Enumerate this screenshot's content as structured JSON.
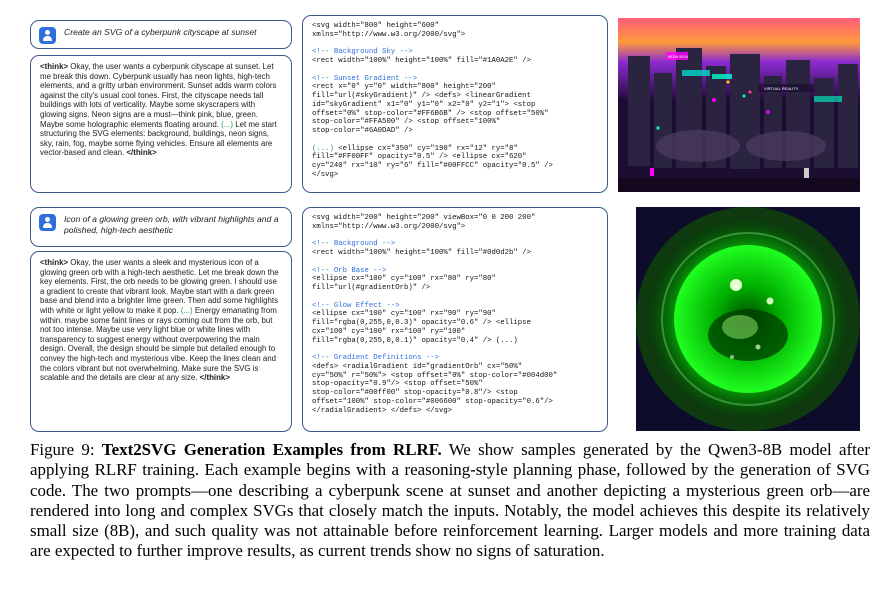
{
  "example1": {
    "prompt": "Create an SVG of a cyberpunk cityscape at sunset",
    "think_open": "<think>",
    "think_body": " Okay, the user wants a cyberpunk cityscape at sunset. Let me break this down. Cyberpunk usually has neon lights, high-tech elements, and a gritty urban environment. Sunset adds warm colors against the city's usual cool tones. First, the cityscape needs tall buildings with lots of verticality. Maybe some skyscrapers with glowing signs. Neon signs are a must—think pink, blue, green. Maybe some holographic elements floating around. ",
    "think_ellipsis": "(...)",
    "think_tail": " Let me start structuring the SVG elements: background, buildings, neon signs, sky, rain, fog, maybe some flying vehicles. Ensure all elements are vector-based and clean.",
    "think_close": "</think>",
    "code_lines": [
      {
        "t": "<svg width=\"800\" height=\"600\"",
        "c": "code"
      },
      {
        "t": "xmlns=\"http://www.w3.org/2000/svg\">",
        "c": "code"
      },
      {
        "t": "",
        "c": "blank"
      },
      {
        "t": "<!-- Background Sky -->",
        "c": "cm"
      },
      {
        "t": "<rect width=\"100%\" height=\"100%\" fill=\"#1A0A2E\" />",
        "c": "code"
      },
      {
        "t": "",
        "c": "blank"
      },
      {
        "t": "<!-- Sunset Gradient -->",
        "c": "cm"
      },
      {
        "t": "<rect x=\"0\" y=\"0\" width=\"800\" height=\"200\"",
        "c": "code"
      },
      {
        "t": "fill=\"url(#skyGradient)\" /> <defs> <linearGradient",
        "c": "code"
      },
      {
        "t": "id=\"skyGradient\" x1=\"0\" y1=\"0\" x2=\"0\" y2=\"1\"> <stop",
        "c": "code"
      },
      {
        "t": "offset=\"0%\" stop-color=\"#FF6B6B\" /> <stop offset=\"50%\"",
        "c": "code"
      },
      {
        "t": "stop-color=\"#FFA500\" /> <stop offset=\"100%\"",
        "c": "code"
      },
      {
        "t": "stop-color=\"#6A0DAD\" />",
        "c": "code"
      },
      {
        "t": "",
        "c": "blank"
      },
      {
        "t": "(...)",
        "c": "ell",
        "rest": " <ellipse cx=\"350\" cy=\"190\" rx=\"12\" ry=\"8\""
      },
      {
        "t": "fill=\"#FF00FF\" opacity=\"0.5\" /> <ellipse cx=\"620\"",
        "c": "code"
      },
      {
        "t": "cy=\"240\" rx=\"10\" ry=\"6\" fill=\"#00FFCC\" opacity=\"0.5\" />",
        "c": "code"
      },
      {
        "t": "</svg>",
        "c": "code"
      }
    ],
    "image_labels": {
      "sign1": "NEON SIGN",
      "sign2": "VIRTUAL REALITY"
    }
  },
  "example2": {
    "prompt": "Icon of a glowing green orb, with vibrant highlights and a polished, high-tech aesthetic",
    "think_open": "<think>",
    "think_body": " Okay, the user wants a sleek and mysterious icon of a glowing green orb with a high-tech aesthetic. Let me break down the key elements. First, the orb needs to be glowing green. I should use a gradient to create that vibrant look. Maybe start with a dark green base and blend into a brighter lime green. Then add some highlights with white or light yellow to make it pop. ",
    "think_ellipsis": "(...)",
    "think_tail": " Energy emanating from within. maybe some faint lines or rays coming out from the orb, but not too intense. Maybe use very light blue or white lines with transparency to suggest energy without overpowering the main design. Overall, the design should be simple but detailed enough to convey the high-tech and mysterious vibe. Keep the lines clean and the colors vibrant but not overwhelming. Make sure the SVG is scalable and the details are clear at any size.",
    "think_close": "</think>",
    "code_lines": [
      {
        "t": "<svg width=\"200\" height=\"200\" viewBox=\"0 0 200 200\"",
        "c": "code"
      },
      {
        "t": "xmlns=\"http://www.w3.org/2000/svg\">",
        "c": "code"
      },
      {
        "t": "",
        "c": "blank"
      },
      {
        "t": "<!-- Background -->",
        "c": "cm"
      },
      {
        "t": "<rect width=\"100%\" height=\"100%\" fill=\"#0d0d2b\" />",
        "c": "code"
      },
      {
        "t": "",
        "c": "blank"
      },
      {
        "t": "<!-- Orb Base -->",
        "c": "cm"
      },
      {
        "t": "<ellipse cx=\"100\" cy=\"100\" rx=\"80\" ry=\"80\"",
        "c": "code"
      },
      {
        "t": "fill=\"url(#gradientOrb)\" />",
        "c": "code"
      },
      {
        "t": "",
        "c": "blank"
      },
      {
        "t": "<!-- Glow Effect -->",
        "c": "cm"
      },
      {
        "t": "<ellipse cx=\"100\" cy=\"100\" rx=\"90\" ry=\"90\"",
        "c": "code"
      },
      {
        "t": "fill=\"rgba(0,255,0,0.3)\" opacity=\"0.6\" /> <ellipse",
        "c": "code"
      },
      {
        "t": "cx=\"100\" cy=\"100\" rx=\"100\" ry=\"100\"",
        "c": "code"
      },
      {
        "t": "fill=\"rgba(0,255,0,0.1)\" opacity=\"0.4\" /> (...)",
        "c": "code"
      },
      {
        "t": "",
        "c": "blank"
      },
      {
        "t": "<!-- Gradient Definitions -->",
        "c": "cm"
      },
      {
        "t": "<defs> <radialGradient id=\"gradientOrb\" cx=\"50%\"",
        "c": "code"
      },
      {
        "t": "cy=\"50%\" r=\"50%\"> <stop offset=\"0%\" stop-color=\"#004d00\"",
        "c": "code"
      },
      {
        "t": "stop-opacity=\"0.9\"/> <stop offset=\"50%\"",
        "c": "code"
      },
      {
        "t": "stop-color=\"#00ff00\" stop-opacity=\"0.8\"/> <stop",
        "c": "code"
      },
      {
        "t": "offset=\"100%\" stop-color=\"#006600\" stop-opacity=\"0.6\"/>",
        "c": "code"
      },
      {
        "t": "</radialGradient> </defs> </svg>",
        "c": "code"
      }
    ]
  },
  "caption": {
    "label": "Figure 9: ",
    "title": "Text2SVG Generation Examples from RLRF.",
    "body": " We show samples generated by the Qwen3-8B model after applying RLRF training. Each example begins with a reasoning-style planning phase, followed by the generation of SVG code. The two prompts—one describing a cyberpunk scene at sunset and another depicting a mysterious green orb—are rendered into long and complex SVGs that closely match the inputs. Notably, the model achieves this despite its relatively small size (8B), and such quality was not attainable before reinforcement learning. Larger models and more training data are expected to further improve results, as current trends show no signs of saturation."
  },
  "colors": {
    "border": "#3d5a8c",
    "comment": "#2f6fdb",
    "ellipsis": "#2a9a45",
    "user_icon": "#2f6fdb"
  }
}
